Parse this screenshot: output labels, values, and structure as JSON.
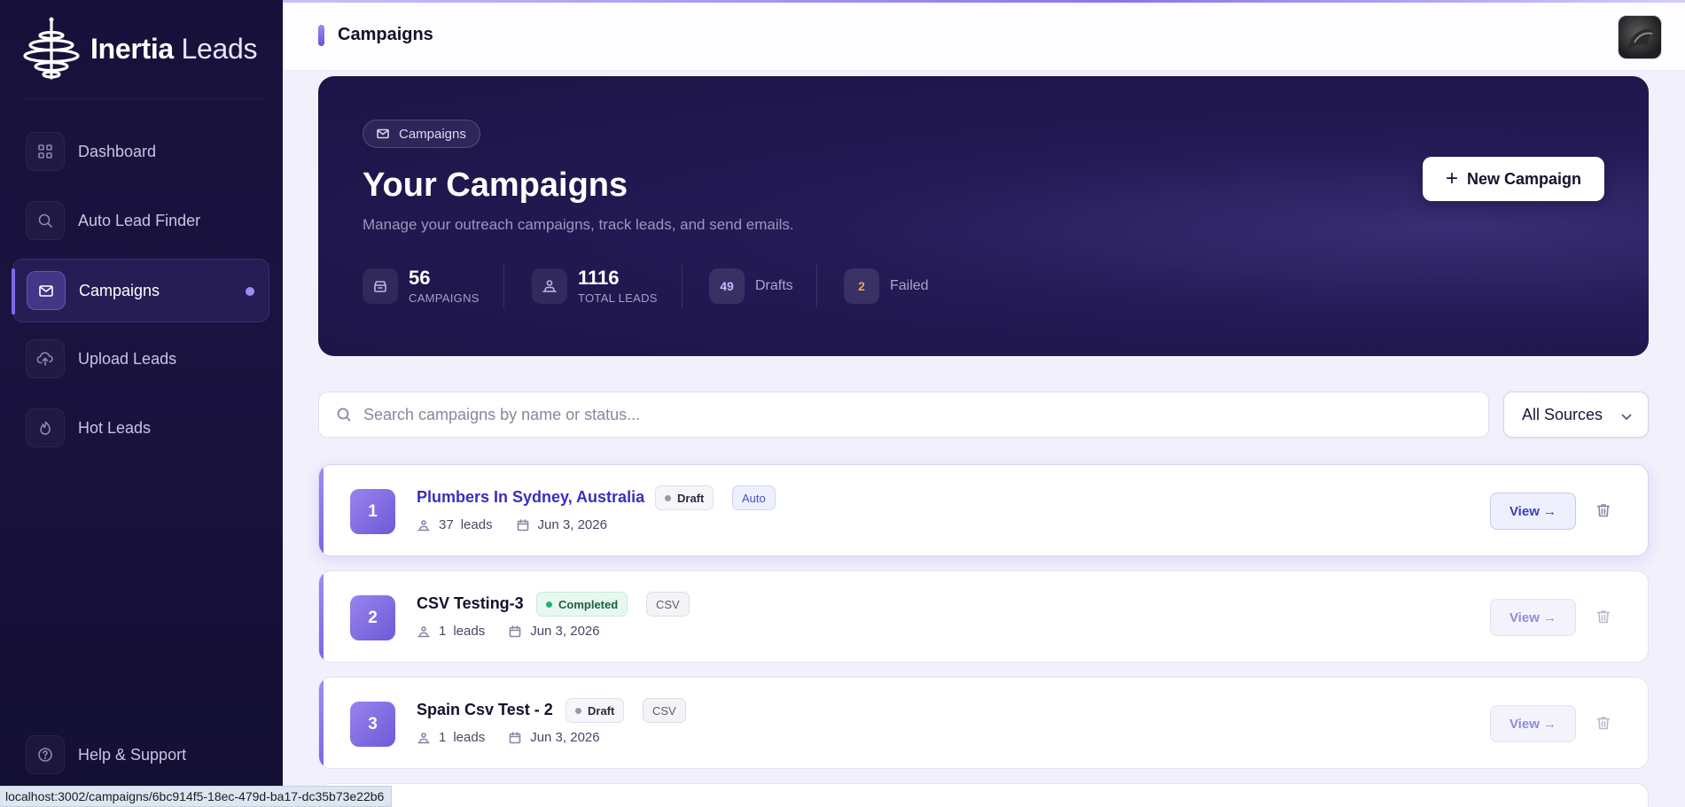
{
  "brand": {
    "name_bold": "Inertia",
    "name_light": "Leads"
  },
  "sidebar": {
    "items": [
      {
        "label": "Dashboard",
        "icon": "grid-icon"
      },
      {
        "label": "Auto Lead Finder",
        "icon": "search-icon"
      },
      {
        "label": "Campaigns",
        "icon": "mail-icon",
        "active": true
      },
      {
        "label": "Upload Leads",
        "icon": "cloud-upload-icon"
      },
      {
        "label": "Hot Leads",
        "icon": "flame-icon"
      }
    ],
    "footer": {
      "label": "Help & Support",
      "icon": "help-icon"
    }
  },
  "header": {
    "title": "Campaigns"
  },
  "hero": {
    "chip": "Campaigns",
    "title": "Your Campaigns",
    "subtitle": "Manage your outreach campaigns, track leads, and send emails.",
    "new_button": "New Campaign",
    "stats": {
      "campaigns": {
        "value": "56",
        "label": "CAMPAIGNS"
      },
      "leads": {
        "value": "1116",
        "label": "TOTAL LEADS"
      },
      "drafts": {
        "value": "49",
        "label": "Drafts"
      },
      "failed": {
        "value": "2",
        "label": "Failed"
      }
    }
  },
  "search": {
    "placeholder": "Search campaigns by name or status..."
  },
  "filter": {
    "selected": "All Sources"
  },
  "campaigns": [
    {
      "index": "1",
      "name": "Plumbers In Sydney, Australia",
      "status": "Draft",
      "source": "Auto",
      "leads": "37",
      "leads_word": "leads",
      "date": "Jun 3, 2026",
      "view": "View →"
    },
    {
      "index": "2",
      "name": "CSV Testing-3",
      "status": "Completed",
      "source": "CSV",
      "leads": "1",
      "leads_word": "leads",
      "date": "Jun 3, 2026",
      "view": "View →"
    },
    {
      "index": "3",
      "name": "Spain Csv Test - 2",
      "status": "Draft",
      "source": "CSV",
      "leads": "1",
      "leads_word": "leads",
      "date": "Jun 3, 2026",
      "view": "View →"
    }
  ],
  "statusbar": {
    "url": "localhost:3002/campaigns/6bc914f5-18ec-479d-ba17-dc35b73e22b6"
  },
  "colors": {
    "accent": "#7b66e3",
    "sidebar_bg": "#17113a",
    "hero_bg": "#241a55",
    "draft_count": "#c8b8ff",
    "failed_count": "#f0a35a"
  }
}
